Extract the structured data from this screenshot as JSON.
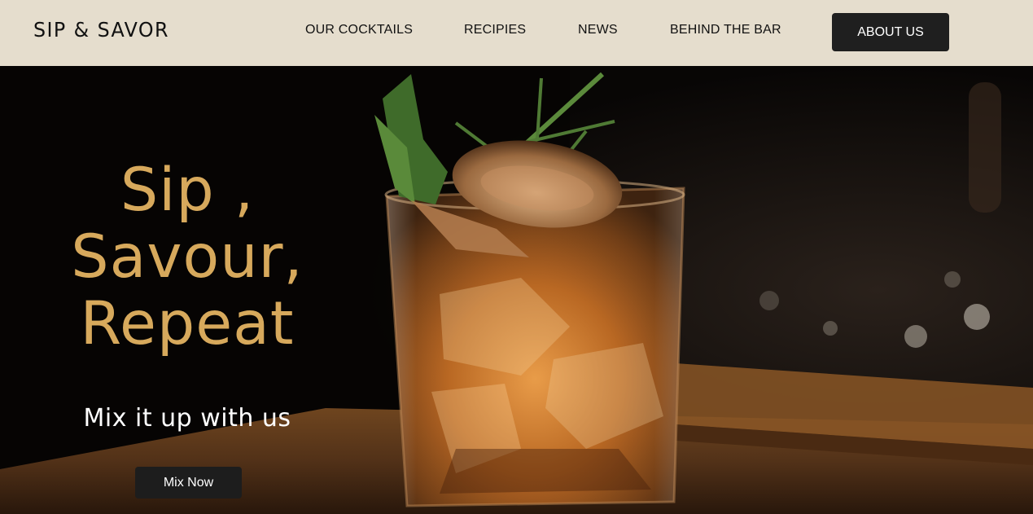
{
  "brand": {
    "logo": "SIP & SAVOR"
  },
  "nav": {
    "items": [
      {
        "label": "OUR COCKTAILS"
      },
      {
        "label": "RECIPIES"
      },
      {
        "label": "NEWS"
      },
      {
        "label": "BEHIND THE BAR"
      }
    ],
    "about_button": "ABOUT US"
  },
  "hero": {
    "headline": [
      "Sip ,",
      "Savour,",
      "Repeat"
    ],
    "tagline": "Mix it up with us",
    "cta_label": "Mix Now",
    "image_subject": "cocktail-glass-photo"
  },
  "colors": {
    "nav_background": "#e5ddcd",
    "headline": "#d7a95c",
    "button_dark": "#1f1f1f",
    "tagline": "#ffffff"
  }
}
